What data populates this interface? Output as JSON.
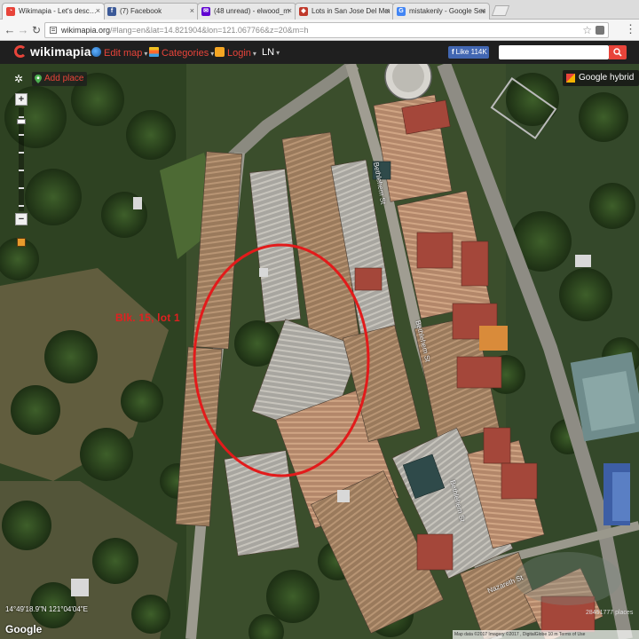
{
  "browser": {
    "tabs": [
      {
        "title": "Wikimapia - Let's desc…",
        "favicon": "wikimapia-icon",
        "color": "#e8443a",
        "glyph": "◔"
      },
      {
        "title": "(7) Facebook",
        "favicon": "facebook-icon",
        "color": "#3b5998",
        "glyph": "f"
      },
      {
        "title": "(48 unread) - elwood_m",
        "favicon": "yahoo-mail-icon",
        "color": "#6001d2",
        "glyph": "✉"
      },
      {
        "title": "Lots in San Jose Del Mon",
        "favicon": "page-icon",
        "color": "#c0392b",
        "glyph": "◆"
      },
      {
        "title": "mistakenly - Google Sea",
        "favicon": "google-icon",
        "color": "#4285f4",
        "glyph": "G"
      }
    ],
    "url_host": "wikimapia.org",
    "url_rest": "/#lang=en&lat=14.821904&lon=121.067766&z=20&m=h"
  },
  "wikimapia": {
    "logo_text": "wikimapia",
    "menu": {
      "edit_map": "Edit map",
      "categories": "Categories",
      "login": "Login",
      "language": "LN"
    },
    "fb_like": {
      "label": "Like",
      "count": "114K"
    },
    "search_placeholder": "",
    "add_place": "Add place",
    "map_type": "Google hybrid"
  },
  "map": {
    "annotation": "Blk. 15, lot 1",
    "annotation_color": "#e02020",
    "streets": {
      "s1": "Bethlehem St",
      "s2": "Bethlehem St",
      "s3": "Bethlehem St",
      "s4": "Nazareth St"
    },
    "coordinates": "14°49'18.9\"N 121°04'04\"E",
    "google_mark": "Google",
    "places_count": "28451777 places",
    "attribution": "Map data ©2017 Imagery ©2017 , DigitalGlobe  10 m  Terms of Use",
    "zoom_level_fraction": 0.88
  }
}
